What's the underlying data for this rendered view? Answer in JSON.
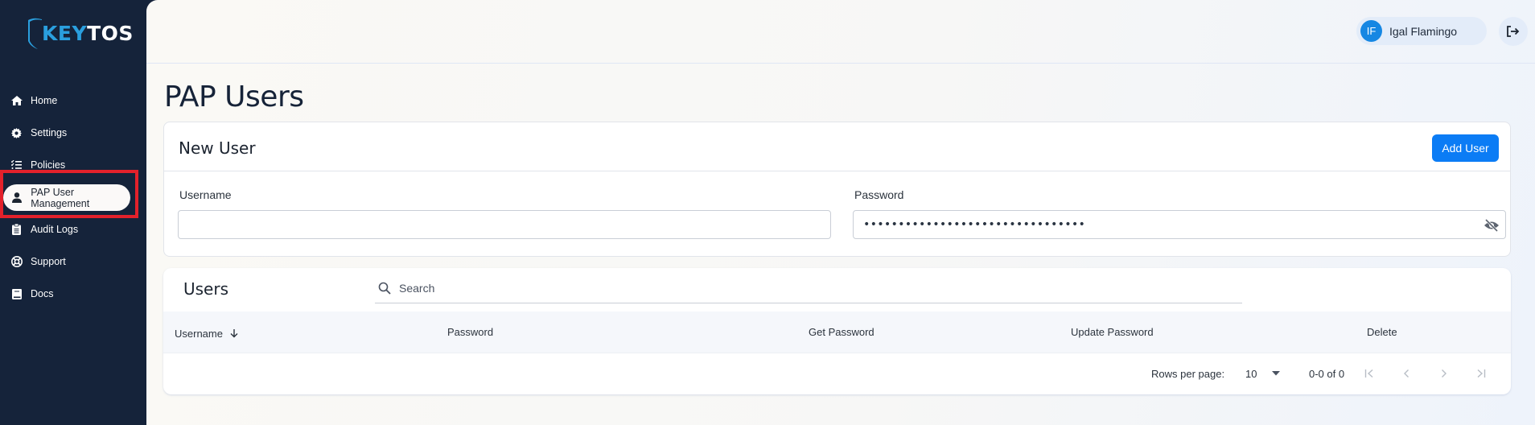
{
  "brand": {
    "key": "KEY",
    "tos": "TOS",
    "accent": "#2a9fde"
  },
  "sidebar": {
    "items": [
      {
        "label": "Home",
        "icon": "home-icon"
      },
      {
        "label": "Settings",
        "icon": "gear-icon"
      },
      {
        "label": "Policies",
        "icon": "list-check-icon"
      },
      {
        "label": "PAP User Management",
        "icon": "user-icon",
        "active": true
      },
      {
        "label": "Audit Logs",
        "icon": "clipboard-icon"
      },
      {
        "label": "Support",
        "icon": "life-ring-icon"
      },
      {
        "label": "Docs",
        "icon": "book-icon"
      }
    ]
  },
  "header": {
    "user": {
      "initials": "IF",
      "name": "Igal Flamingo"
    },
    "logout_icon": "logout-icon"
  },
  "page": {
    "title": "PAP Users"
  },
  "new_user": {
    "title": "New User",
    "add_button": "Add User",
    "username": {
      "label": "Username",
      "value": "",
      "placeholder": ""
    },
    "password": {
      "label": "Password",
      "masked_value": "••••••••••••••••••••••••••••••••",
      "visibility_icon": "eye-slash-icon"
    }
  },
  "users": {
    "title": "Users",
    "search": {
      "placeholder": "Search",
      "value": ""
    },
    "columns": [
      {
        "label": "Username",
        "sort": "descending"
      },
      {
        "label": "Password"
      },
      {
        "label": "Get Password"
      },
      {
        "label": "Update Password"
      },
      {
        "label": "Delete"
      }
    ],
    "rows": [],
    "pagination": {
      "rows_per_page_label": "Rows per page:",
      "rows_per_page": "10",
      "range": "0-0 of 0",
      "first": "|<",
      "prev": "<",
      "next": ">",
      "last": ">|"
    }
  },
  "colors": {
    "sidebar_bg": "#15233a",
    "primary_button": "#0b7cf5",
    "avatar": "#1687e3",
    "highlight": "#e3212b"
  }
}
